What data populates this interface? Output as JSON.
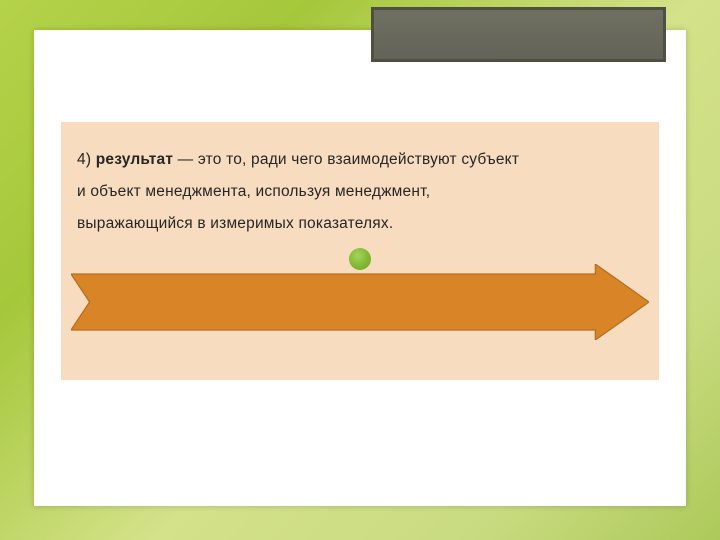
{
  "text": {
    "num": "4) ",
    "term": "результат",
    "rest1": " — это то, ради чего взаимодействуют субъект",
    "line2": "и объект менеджмента, используя менеджмент,",
    "line3": "выражающийся в измеримых показателях."
  },
  "colors": {
    "arrow_fill": "#d98426",
    "arrow_stroke": "#b56e20"
  }
}
